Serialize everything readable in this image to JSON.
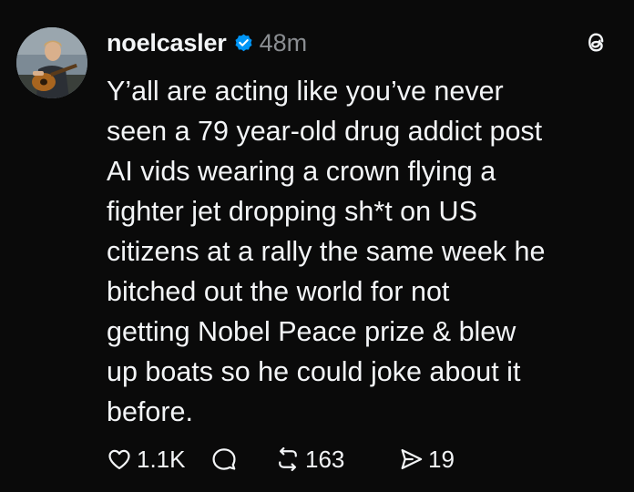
{
  "post": {
    "username": "noelcasler",
    "timestamp": "48m",
    "body_lines": [
      "Y’all are acting like you’ve never",
      "seen a 79 year-old drug addict post",
      "AI vids wearing a crown flying a",
      "fighter jet dropping sh*t on US",
      "citizens at a rally the same week he",
      "bitched out the world for not",
      "getting Nobel Peace prize & blew",
      "up boats so he could joke about it",
      "before."
    ],
    "actions": {
      "like_count": "1.1K",
      "reply_count": "",
      "repost_count": "163",
      "share_count": "19"
    }
  },
  "icons": {
    "verified": "verified-badge-icon",
    "logo": "threads-logo-icon",
    "like": "heart-icon",
    "reply": "comment-bubble-icon",
    "repost": "repost-icon",
    "share": "share-icon"
  },
  "colors": {
    "background": "#0a0a0a",
    "text": "#f3f5f7",
    "muted": "#8a8d91",
    "verified": "#0095f6"
  }
}
